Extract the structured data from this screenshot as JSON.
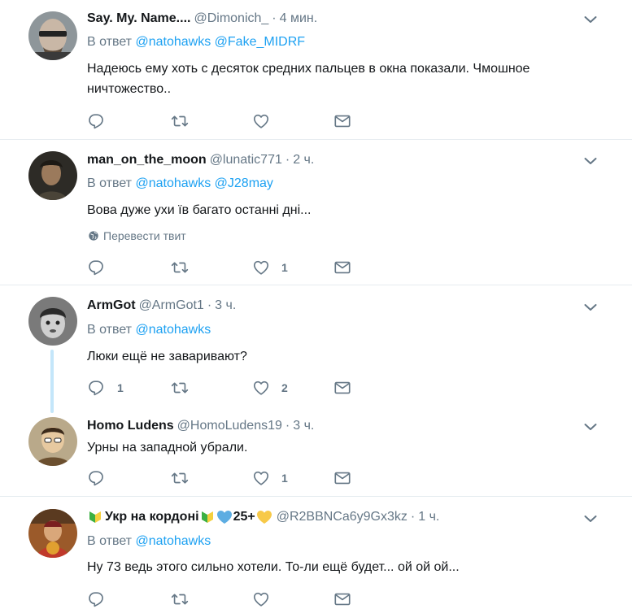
{
  "tweets": [
    {
      "name": "Say. My. Name....",
      "handle": "@Dimonich_",
      "dot": "·",
      "time": "4 мин.",
      "reply_prefix": "В ответ",
      "reply_to": [
        "@natohawks",
        "@Fake_MIDRF"
      ],
      "text": "Надеюсь ему хоть с десяток средних пальцев в окна показали. Чмошное ничтожество..",
      "reply_count": "",
      "like_count": ""
    },
    {
      "name": "man_on_the_moon",
      "handle": "@lunatic771",
      "dot": "·",
      "time": "2 ч.",
      "reply_prefix": "В ответ",
      "reply_to": [
        "@natohawks",
        "@J28may"
      ],
      "text": "Вова дуже ухи їв багато останні дні...",
      "translate": "Перевести твит",
      "reply_count": "",
      "like_count": "1"
    },
    {
      "name": "ArmGot",
      "handle": "@ArmGot1",
      "dot": "·",
      "time": "3 ч.",
      "reply_prefix": "В ответ",
      "reply_to": [
        "@natohawks"
      ],
      "text": "Люки ещё не заваривают?",
      "reply_count": "1",
      "like_count": "2"
    },
    {
      "name": "Homo Ludens",
      "handle": "@HomoLudens19",
      "dot": "·",
      "time": "3 ч.",
      "text": "Урны на западной убрали.",
      "reply_count": "",
      "like_count": "1"
    },
    {
      "name": "Укр на кордоні",
      "name_suffix": "25+",
      "handle": "@R2BBNCa6y9Gx3kz",
      "dot": "·",
      "time": "1 ч.",
      "reply_prefix": "В ответ",
      "reply_to": [
        "@natohawks"
      ],
      "text": "Ну 73 ведь этого сильно хотели. То-ли ещё будет... ой ой ой...",
      "reply_count": "",
      "like_count": ""
    }
  ],
  "icons": {
    "reply": "reply-icon",
    "retweet": "retweet-icon",
    "like": "heart-icon",
    "dm": "envelope-icon",
    "more": "chevron-down-icon",
    "globe": "globe-icon"
  },
  "colors": {
    "link": "#1da1f2",
    "muted": "#657786",
    "text": "#14171a",
    "separator": "#e6ecf0",
    "thread_line": "#c4e6fa"
  }
}
